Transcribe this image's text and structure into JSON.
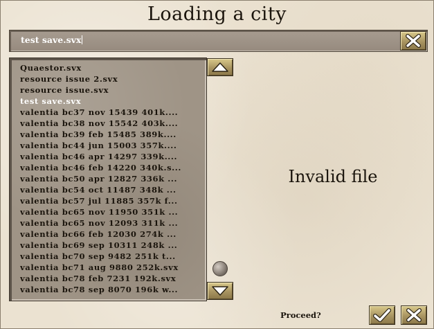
{
  "dialog": {
    "title": "Loading a city"
  },
  "filename_field": {
    "value": "test save.svx"
  },
  "file_list": {
    "selected_index": 3,
    "items": [
      "Quaestor.svx",
      "resource issue 2.svx",
      "resource issue.svx",
      "test save.svx",
      "valentia bc37 nov 15439 401k....",
      "valentia bc38 nov 15542 403k....",
      "valentia bc39 feb 15485 389k....",
      "valentia bc44 jun 15003 357k....",
      "valentia bc46 apr 14297 339k....",
      "valentia bc46 feb 14220 340k.s...",
      "valentia bc50 apr 12827 336k ...",
      "valentia bc54 oct 11487 348k ...",
      "valentia bc57 jul 11885 357k f...",
      "valentia bc65 nov 11950 351k ...",
      "valentia bc65 nov 12093 311k ...",
      "valentia bc66 feb 12030 274k ...",
      "valentia bc69 sep 10311 248k ...",
      "valentia bc70 sep 9482 251k t...",
      "valentia bc71 aug 9880 252k.svx",
      "valentia bc78 feb 7231 192k.svx",
      "valentia bc78 sep 8070 196k w..."
    ]
  },
  "status_message": "Invalid file",
  "footer": {
    "proceed_label": "Proceed?"
  },
  "icons": {
    "clear": "x-icon",
    "scroll_up": "triangle-up-icon",
    "scroll_down": "triangle-down-icon",
    "confirm": "checkmark-icon",
    "cancel": "x-icon"
  },
  "colors": {
    "panel_background": "#ebe2d1",
    "list_background": "#9f9486",
    "button_gold": "#a89461",
    "selected_text": "#ffffff",
    "text": "#1a140c"
  }
}
